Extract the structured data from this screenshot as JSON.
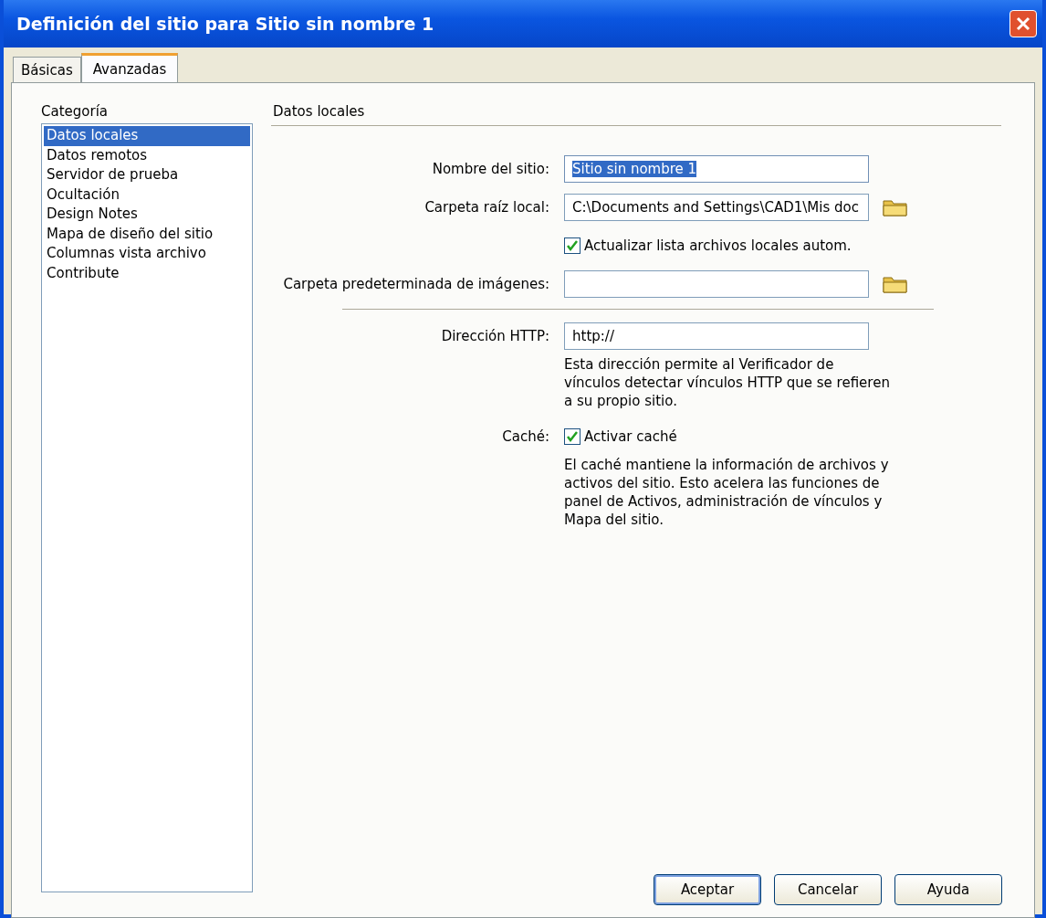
{
  "window": {
    "title": "Definición del sitio para Sitio sin nombre 1"
  },
  "tabs": [
    {
      "label": "Básicas",
      "selected": false
    },
    {
      "label": "Avanzadas",
      "selected": true
    }
  ],
  "category": {
    "label": "Categoría",
    "items": [
      {
        "label": "Datos locales",
        "selected": true
      },
      {
        "label": "Datos remotos",
        "selected": false
      },
      {
        "label": "Servidor de prueba",
        "selected": false
      },
      {
        "label": "Ocultación",
        "selected": false
      },
      {
        "label": "Design Notes",
        "selected": false
      },
      {
        "label": "Mapa de diseño del sitio",
        "selected": false
      },
      {
        "label": "Columnas vista archivo",
        "selected": false
      },
      {
        "label": "Contribute",
        "selected": false
      }
    ]
  },
  "section": {
    "title": "Datos locales"
  },
  "rows": [
    {
      "kind": "field",
      "label": "Nombre del sitio:",
      "value": "Sitio sin nombre 1",
      "highlighted": true,
      "browse": false
    },
    {
      "kind": "field",
      "label": "Carpeta raíz local:",
      "value": "C:\\Documents and Settings\\CAD1\\Mis doc",
      "highlighted": false,
      "browse": true
    },
    {
      "kind": "checkbox",
      "label": "",
      "text": "Actualizar lista archivos locales autom.",
      "checked": true
    },
    {
      "kind": "field",
      "label": "Carpeta predeterminada de imágenes:",
      "value": "",
      "highlighted": false,
      "browse": true
    },
    {
      "kind": "divider"
    },
    {
      "kind": "field",
      "label": "Dirección HTTP:",
      "value": "http://",
      "highlighted": false,
      "browse": false
    },
    {
      "kind": "note",
      "text": "Esta dirección permite al Verificador de vínculos detectar vínculos HTTP que se refieren a su propio sitio."
    },
    {
      "kind": "checkbox",
      "label": "Caché:",
      "text": "Activar caché",
      "checked": true
    },
    {
      "kind": "note",
      "text": "El caché mantiene la información de archivos y activos del sitio. Esto acelera las funciones de panel de Activos, administración de vínculos y Mapa del sitio."
    }
  ],
  "buttons": [
    {
      "label": "Aceptar",
      "default": true
    },
    {
      "label": "Cancelar",
      "default": false
    },
    {
      "label": "Ayuda",
      "default": false
    }
  ]
}
